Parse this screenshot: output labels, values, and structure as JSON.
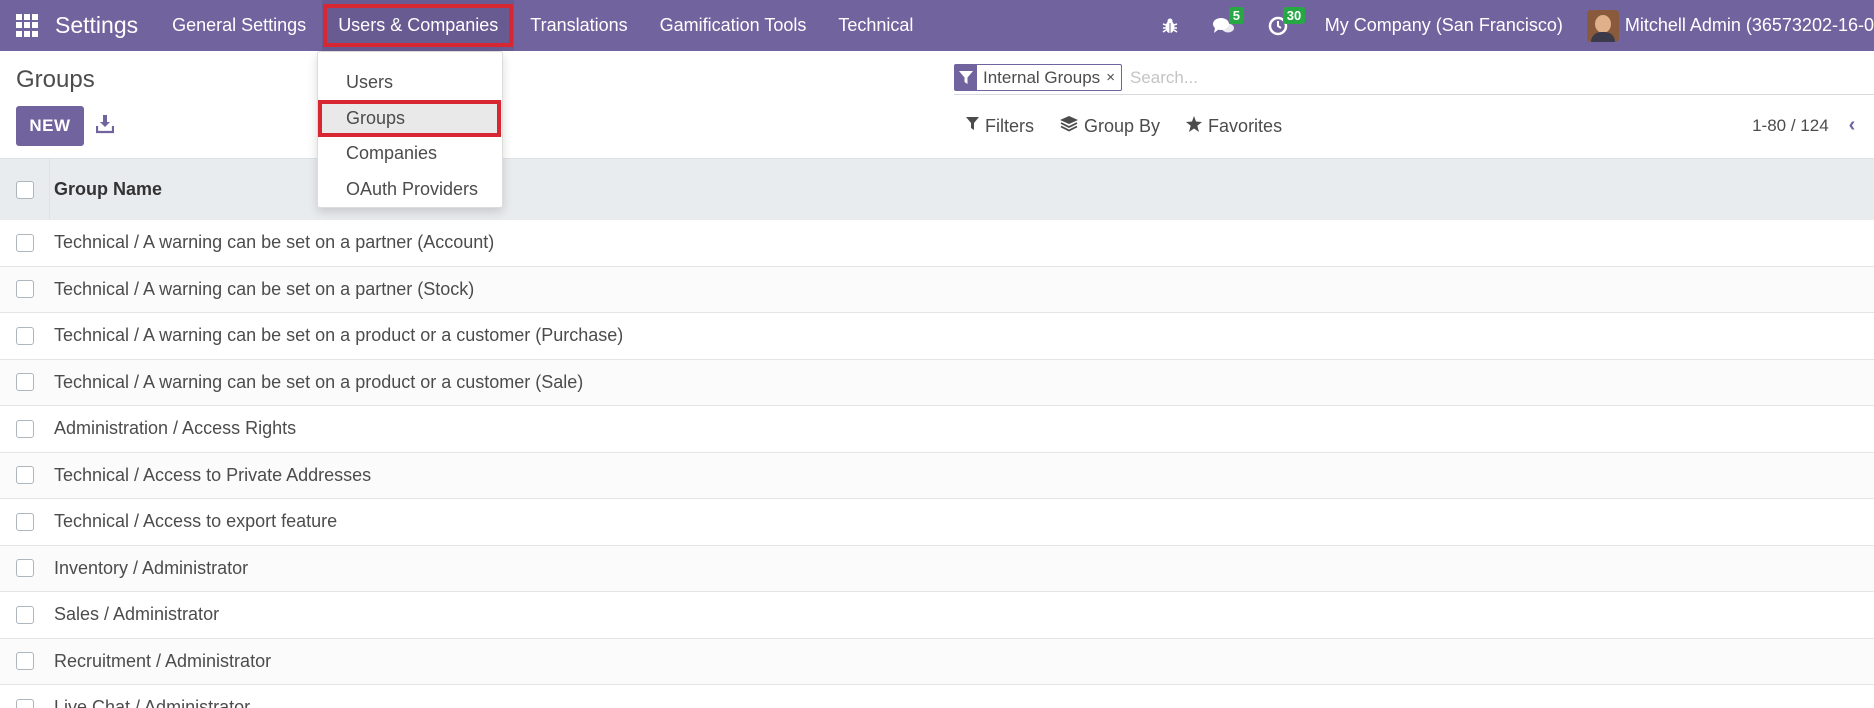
{
  "navbar": {
    "app_title": "Settings",
    "menu": [
      {
        "label": "General Settings",
        "active": false
      },
      {
        "label": "Users & Companies",
        "active": true
      },
      {
        "label": "Translations",
        "active": false
      },
      {
        "label": "Gamification Tools",
        "active": false
      },
      {
        "label": "Technical",
        "active": false
      }
    ],
    "debug_icon": "bug-icon",
    "messages_badge": "5",
    "activities_badge": "30",
    "company": "My Company (San Francisco)",
    "user": "Mitchell Admin (36573202-16-0"
  },
  "dropdown": {
    "items": [
      {
        "label": "Users",
        "active": false
      },
      {
        "label": "Groups",
        "active": true
      },
      {
        "label": "Companies",
        "active": false
      },
      {
        "label": "OAuth Providers",
        "active": false
      }
    ]
  },
  "control_panel": {
    "title": "Groups",
    "new_label": "NEW",
    "facet_label": "Internal Groups",
    "facet_close": "×",
    "search_placeholder": "Search...",
    "filters_label": "Filters",
    "group_by_label": "Group By",
    "favorites_label": "Favorites",
    "pager": "1-80 / 124"
  },
  "list": {
    "column_header": "Group Name",
    "rows": [
      "Technical / A warning can be set on a partner (Account)",
      "Technical / A warning can be set on a partner (Stock)",
      "Technical / A warning can be set on a product or a customer (Purchase)",
      "Technical / A warning can be set on a product or a customer (Sale)",
      "Administration / Access Rights",
      "Technical / Access to Private Addresses",
      "Technical / Access to export feature",
      "Inventory / Administrator",
      "Sales / Administrator",
      "Recruitment / Administrator",
      "Live Chat / Administrator"
    ]
  },
  "colors": {
    "brand": "#71639e",
    "highlight": "#d62732",
    "badge": "#28a745"
  }
}
